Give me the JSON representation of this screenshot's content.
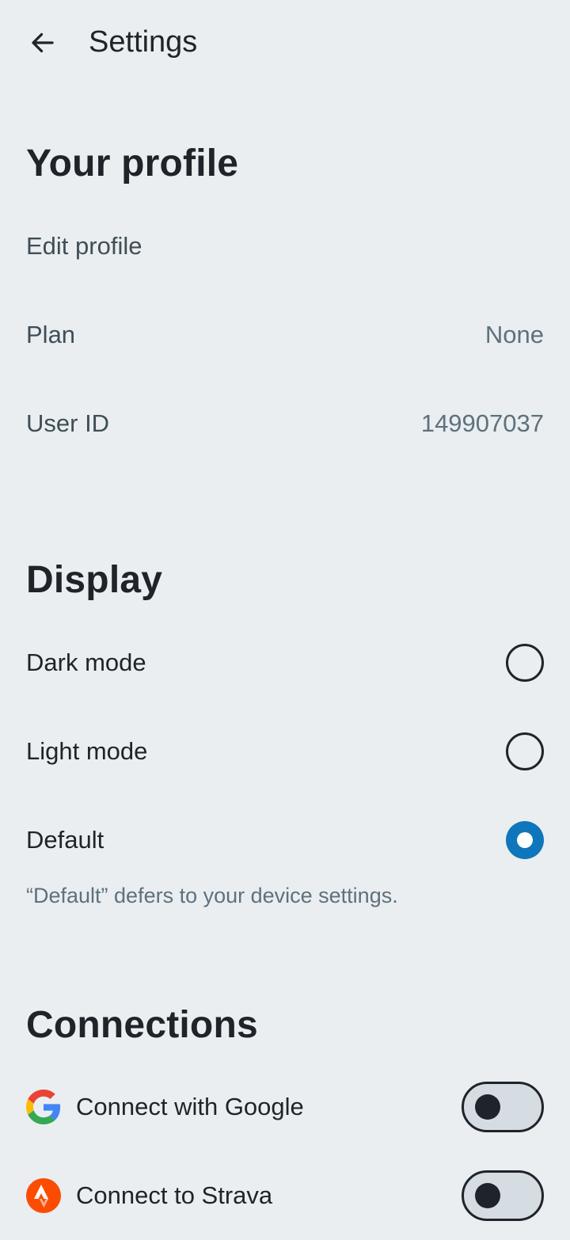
{
  "header": {
    "title": "Settings"
  },
  "profile": {
    "title": "Your profile",
    "edit_label": "Edit profile",
    "plan_label": "Plan",
    "plan_value": "None",
    "userid_label": "User ID",
    "userid_value": "149907037"
  },
  "display": {
    "title": "Display",
    "options": [
      {
        "label": "Dark mode",
        "selected": false
      },
      {
        "label": "Light mode",
        "selected": false
      },
      {
        "label": "Default",
        "selected": true
      }
    ],
    "hint": "“Default” defers to your device settings."
  },
  "connections": {
    "title": "Connections",
    "items": [
      {
        "label": "Connect with Google",
        "icon": "google-icon",
        "enabled": false
      },
      {
        "label": "Connect to Strava",
        "icon": "strava-icon",
        "enabled": false
      }
    ]
  },
  "colors": {
    "background": "#eaeef1",
    "accent": "#0f76bb",
    "text": "#1e2429",
    "muted": "#5e717c",
    "strava": "#fc4c02"
  }
}
